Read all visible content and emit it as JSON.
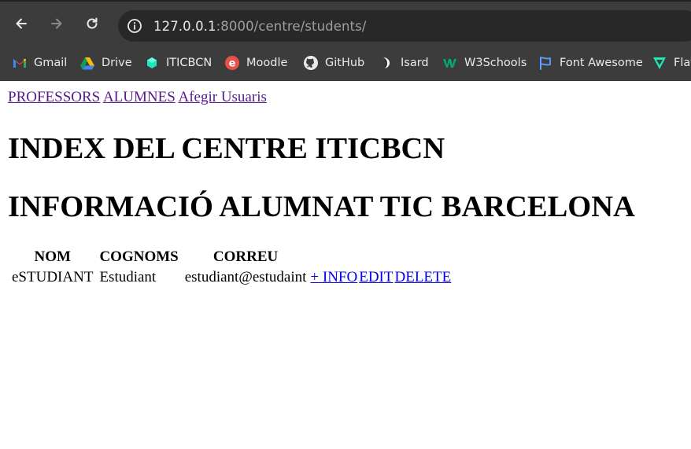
{
  "browser": {
    "url_host": "127.0.0.1",
    "url_rest": ":8000/centre/students/",
    "bookmarks": [
      {
        "label": "Gmail",
        "icon": "gmail-icon"
      },
      {
        "label": "Drive",
        "icon": "drive-icon"
      },
      {
        "label": "ITICBCN",
        "icon": "iticbcn-icon"
      },
      {
        "label": "Moodle",
        "icon": "moodle-icon"
      },
      {
        "label": "GitHub",
        "icon": "github-icon"
      },
      {
        "label": "Isard",
        "icon": "isard-icon"
      },
      {
        "label": "W3Schools",
        "icon": "w3schools-icon"
      },
      {
        "label": "Font Awesome",
        "icon": "font-awesome-icon"
      },
      {
        "label": "Flat",
        "icon": "flat-icon"
      }
    ]
  },
  "nav": {
    "professors": "PROFESSORS",
    "alumnes": "ALUMNES",
    "afegir": "Afegir Usuaris"
  },
  "titles": {
    "index": "INDEX DEL CENTRE ITICBCN",
    "info": "INFORMACIÓ ALUMNAT TIC BARCELONA"
  },
  "table": {
    "headers": [
      "NOM",
      "COGNOMS",
      "CORREU"
    ],
    "rows": [
      {
        "nom": "eSTUDIANT",
        "cognoms": "Estudiant",
        "correu": "estudiant@estudaint",
        "info": "+ INFO",
        "edit": "EDIT",
        "delete": "DELETE"
      }
    ]
  },
  "colors": {
    "chrome_bg": "#3c3c3c",
    "visited_link": "#551a8b",
    "link": "#0000ee"
  }
}
